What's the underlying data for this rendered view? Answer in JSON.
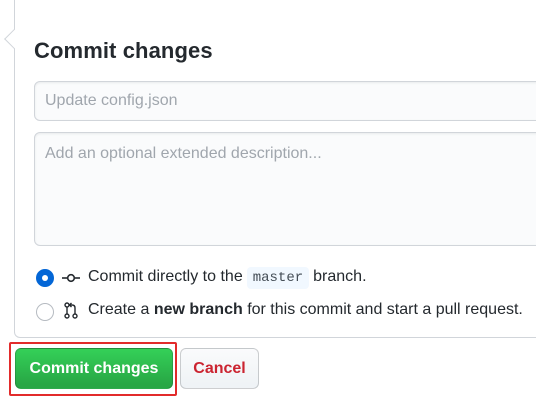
{
  "form": {
    "title": "Commit changes",
    "summary_placeholder": "Update config.json",
    "summary_value": "",
    "description_placeholder": "Add an optional extended description...",
    "description_value": ""
  },
  "options": {
    "direct": {
      "prefix": "Commit directly to the",
      "branch": "master",
      "suffix": "branch.",
      "checked": true,
      "icon": "git-commit-icon"
    },
    "new_branch": {
      "prefix": "Create a",
      "emphasis": "new branch",
      "suffix": "for this commit and start a pull request.",
      "checked": false,
      "icon": "git-pull-request-icon"
    }
  },
  "actions": {
    "commit_label": "Commit changes",
    "cancel_label": "Cancel"
  },
  "colors": {
    "primary_green": "#28a745",
    "cancel_red": "#cb2431",
    "radio_blue": "#0366d6",
    "highlight_red": "#e22b2b"
  }
}
